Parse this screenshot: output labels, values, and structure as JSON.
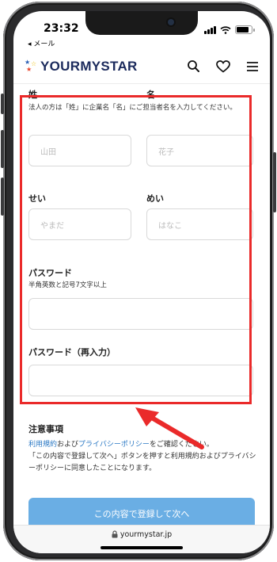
{
  "status": {
    "time": "23:32",
    "back_label": "◂ メール"
  },
  "header": {
    "logo_text": "YOURMYSTAR",
    "icons": [
      "search-icon",
      "heart-icon",
      "menu-icon"
    ]
  },
  "form": {
    "last_name_label": "姓",
    "first_name_label": "名",
    "name_hint": "法人の方は「姓」に企業名「名」にご担当者名を入力してください。",
    "last_name_placeholder": "山田",
    "first_name_placeholder": "花子",
    "last_kana_label": "せい",
    "first_kana_label": "めい",
    "last_kana_placeholder": "やまだ",
    "first_kana_placeholder": "はなこ",
    "password_label": "パスワード",
    "password_hint": "半角英数と記号7文字以上",
    "password_value": "",
    "password_confirm_label": "パスワード（再入力）",
    "password_confirm_value": ""
  },
  "notes": {
    "title": "注意事項",
    "terms_link": "利用規約",
    "and": "および",
    "privacy_link": "プライバシーポリシー",
    "check_text": "をご確認ください。",
    "consent_text": "「この内容で登録して次へ」ボタンを押すと利用規約およびプライバシーポリシーに同意したことになります。"
  },
  "submit_label": "この内容で登録して次へ",
  "url": "yourmystar.jp",
  "colors": {
    "highlight": "#ea2a2a",
    "button": "#6aaee4",
    "link": "#2a78c4",
    "logo": "#1b2a5c"
  }
}
